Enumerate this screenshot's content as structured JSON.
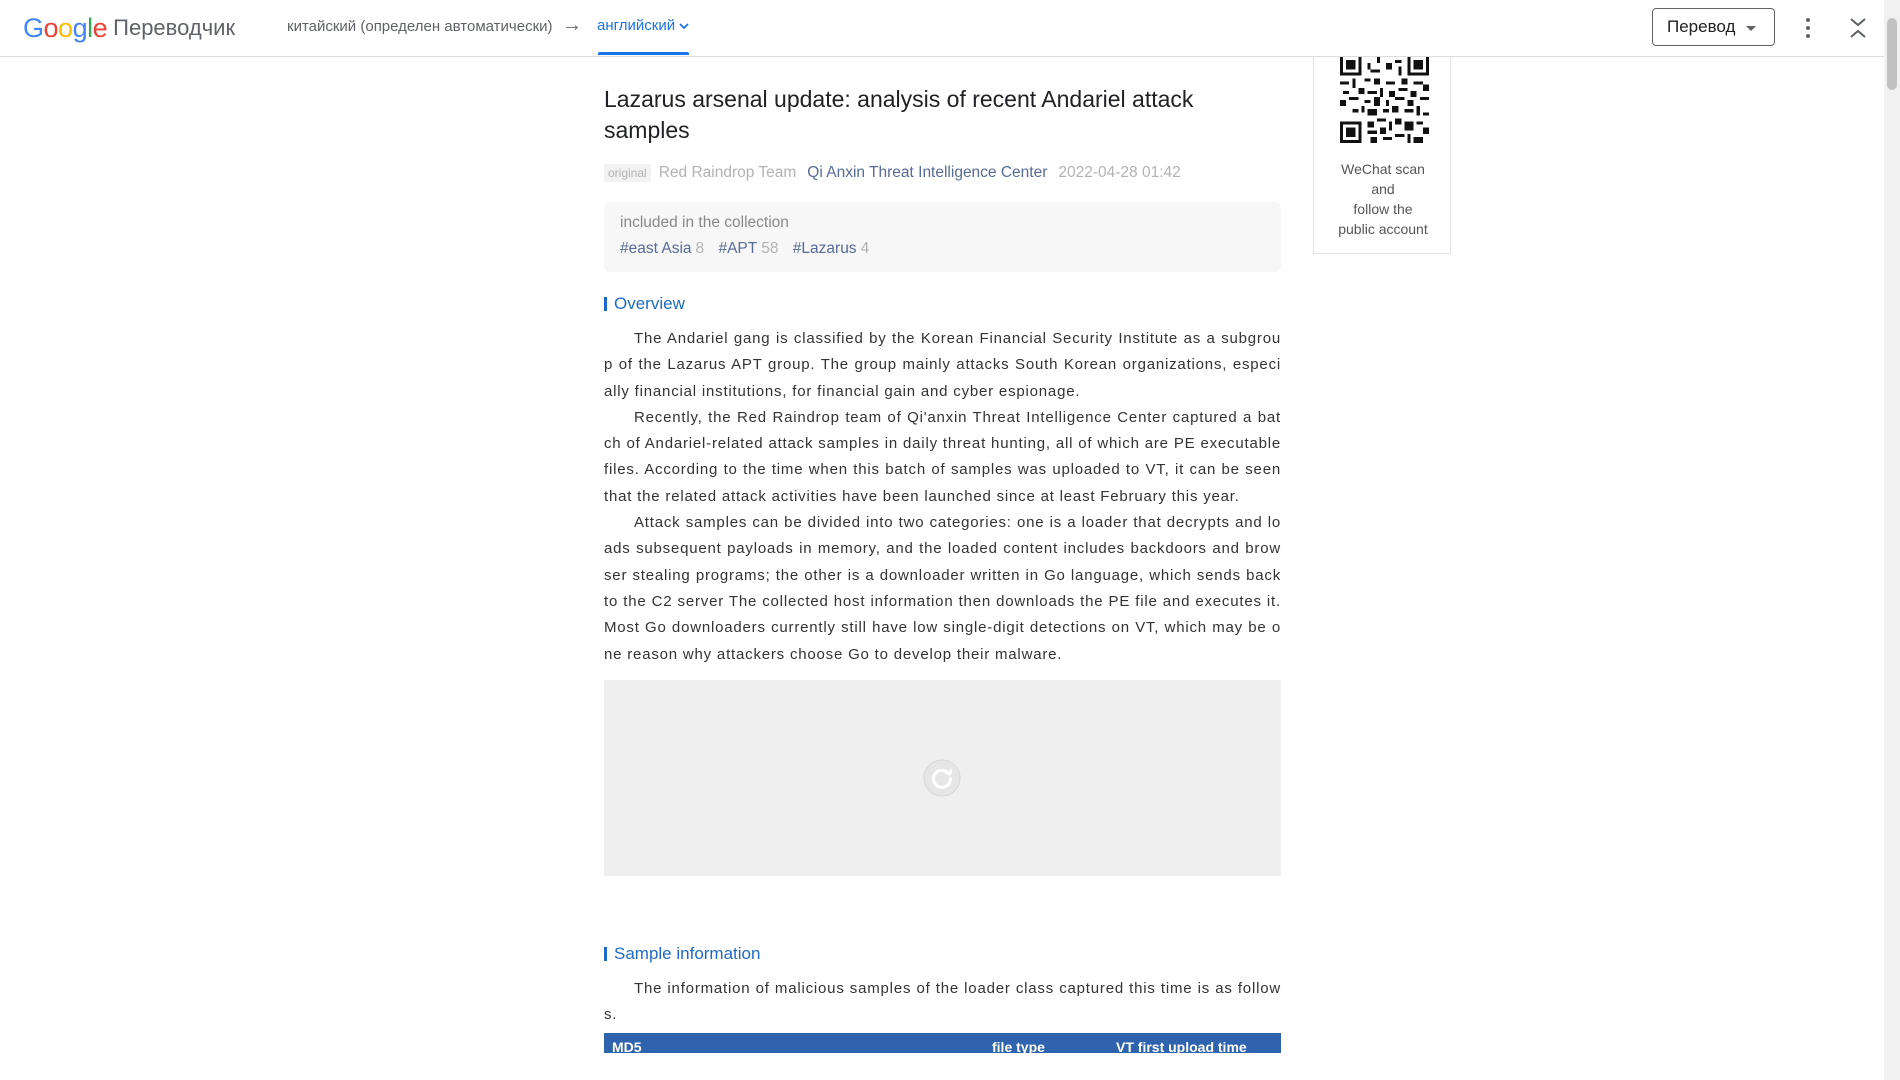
{
  "header": {
    "logo": {
      "letters": [
        "G",
        "o",
        "o",
        "g",
        "l",
        "e"
      ],
      "product": "Переводчик"
    },
    "source_language": "китайский (определен автоматически)",
    "direction_arrow": "→",
    "target_language": "английский",
    "mode_select": "Перевод",
    "icons": [
      "chevron-down-icon",
      "more-vert-icon",
      "collapse-icon"
    ]
  },
  "article": {
    "title": "Lazarus arsenal update: analysis of recent Andariel attack samples",
    "original_tag": "original",
    "author": "Red Raindrop Team",
    "account": "Qi Anxin Threat Intelligence Center",
    "date": "2022-04-28 01:42",
    "collection": {
      "label": "included in the collection",
      "tags": [
        {
          "name": "#east Asia",
          "count": "8"
        },
        {
          "name": "#APT",
          "count": "58"
        },
        {
          "name": "#Lazarus",
          "count": "4"
        }
      ]
    },
    "overview_heading": "Overview",
    "paragraphs": [
      "The Andariel gang is classified by the Korean Financial Security Institute as a subgroup of the Lazarus APT group. The group mainly attacks South Korean organizations, especially financial institutions, for financial gain and cyber espionage.",
      "Recently, the Red Raindrop team of Qi'anxin Threat Intelligence Center captured a batch of Andariel-related attack samples in daily threat hunting, all of which are PE executable files. According to the time when this batch of samples was uploaded to VT, it can be seen that the related attack activities have been launched since at least February this year.",
      "Attack samples can be divided into two categories: one is a loader that decrypts and loads subsequent payloads in memory, and the loaded content includes backdoors and browser stealing programs; the other is a downloader written in Go language, which sends back to the C2 server The collected host information then downloads the PE file and executes it. Most Go downloaders currently still have low single-digit detections on VT, which may be one reason why attackers choose Go to develop their malware."
    ],
    "sample_heading": "Sample information",
    "sample_intro": "The information of malicious samples of the loader class captured this time is as follows.",
    "table_headers": [
      "MD5",
      "file type",
      "VT first upload time"
    ]
  },
  "sidebar": {
    "qr_caption_lines": [
      "WeChat scan",
      "and",
      "follow the",
      "public account"
    ]
  },
  "colors": {
    "accent_blue": "#1a73e8",
    "link_blue": "#576b95",
    "section_blue": "#1e6bc4",
    "table_header_bg": "#2f63ad"
  }
}
